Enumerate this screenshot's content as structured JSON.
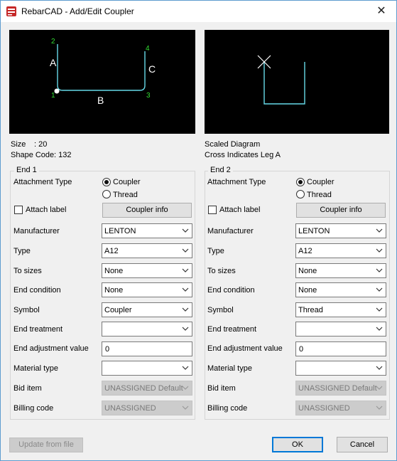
{
  "window": {
    "title": "RebarCAD - Add/Edit Coupler",
    "close_glyph": "✕"
  },
  "shape_diagram": {
    "labels": {
      "A": "A",
      "B": "B",
      "C": "C",
      "n1": "1",
      "n2": "2",
      "n3": "3",
      "n4": "4"
    }
  },
  "info": {
    "size_label": "Size",
    "size_value": ": 20",
    "shape_code_label": "Shape Code",
    "shape_code_value": ": 132",
    "scaled_label": "Scaled Diagram",
    "cross_label": "Cross Indicates Leg A"
  },
  "row_labels": {
    "attachment_type": "Attachment Type",
    "attach_label": "Attach label",
    "manufacturer": "Manufacturer",
    "type": "Type",
    "to_sizes": "To sizes",
    "end_condition": "End condition",
    "symbol": "Symbol",
    "end_treatment": "End treatment",
    "end_adjustment_value": "End adjustment value",
    "material_type": "Material type",
    "bid_item": "Bid item",
    "billing_code": "Billing code"
  },
  "end1": {
    "title": "End 1",
    "radio_coupler": "Coupler",
    "radio_thread": "Thread",
    "selected": "Coupler",
    "attach_label_checked": false,
    "coupler_info_button": "Coupler info",
    "manufacturer": "LENTON",
    "type": "A12",
    "to_sizes": "None",
    "end_condition": "None",
    "symbol": "Coupler",
    "end_treatment": "",
    "end_adjustment_value": "0",
    "material_type": "",
    "bid_item": "UNASSIGNED  Default",
    "billing_code": "UNASSIGNED"
  },
  "end2": {
    "title": "End 2",
    "radio_coupler": "Coupler",
    "radio_thread": "Thread",
    "selected": "Coupler",
    "attach_label_checked": false,
    "coupler_info_button": "Coupler info",
    "manufacturer": "LENTON",
    "type": "A12",
    "to_sizes": "None",
    "end_condition": "None",
    "symbol": "Thread",
    "end_treatment": "",
    "end_adjustment_value": "0",
    "material_type": "",
    "bid_item": "UNASSIGNED  Default",
    "billing_code": "UNASSIGNED"
  },
  "footer": {
    "update_from_file": "Update from file",
    "ok": "OK",
    "cancel": "Cancel"
  },
  "colors": {
    "diagram_line": "#66d9e8",
    "node_label": "#33dd33",
    "accent": "#0078d7"
  }
}
